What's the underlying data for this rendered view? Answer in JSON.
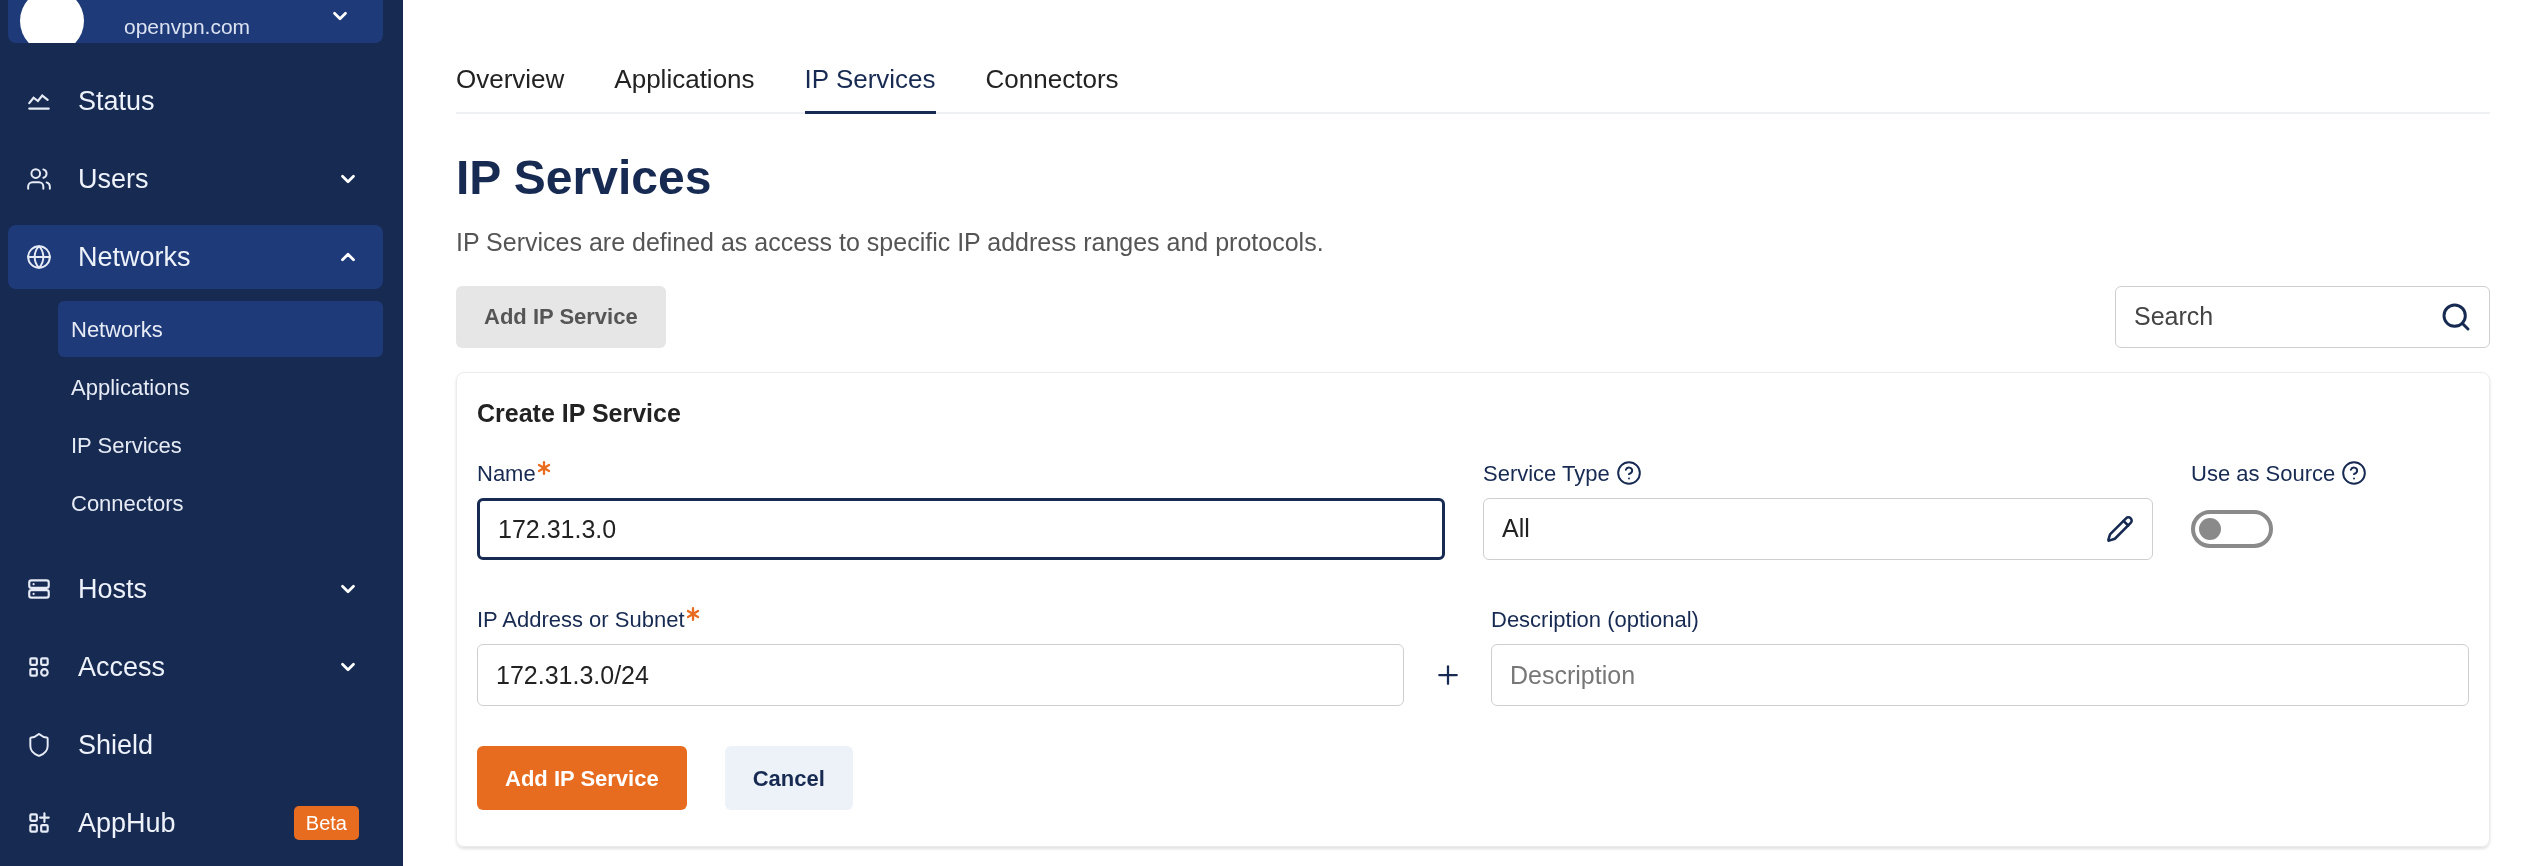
{
  "org": {
    "domain": "openvpn.com"
  },
  "sidebar": {
    "items": [
      {
        "kind": "status",
        "label": "Status",
        "selected": false
      },
      {
        "kind": "users",
        "label": "Users",
        "selected": false,
        "expanded": false
      },
      {
        "kind": "networks",
        "label": "Networks",
        "selected": true,
        "expanded": true,
        "children": [
          {
            "label": "Networks",
            "selected": true
          },
          {
            "label": "Applications",
            "selected": false
          },
          {
            "label": "IP Services",
            "selected": false
          },
          {
            "label": "Connectors",
            "selected": false
          }
        ]
      },
      {
        "kind": "hosts",
        "label": "Hosts",
        "selected": false,
        "expanded": false
      },
      {
        "kind": "access",
        "label": "Access",
        "selected": false,
        "expanded": false
      },
      {
        "kind": "shield",
        "label": "Shield",
        "selected": false
      },
      {
        "kind": "apphub",
        "label": "AppHub",
        "selected": false,
        "badge": "Beta"
      }
    ]
  },
  "tabs": [
    {
      "label": "Overview",
      "selected": false
    },
    {
      "label": "Applications",
      "selected": false
    },
    {
      "label": "IP Services",
      "selected": true
    },
    {
      "label": "Connectors",
      "selected": false
    }
  ],
  "page": {
    "title": "IP Services",
    "description": "IP Services are defined as access to specific IP address ranges and protocols."
  },
  "toolbar": {
    "add_button": "Add IP Service",
    "search": {
      "placeholder": "Search"
    }
  },
  "form": {
    "title": "Create IP Service",
    "name": {
      "label": "Name",
      "required": true,
      "value": "172.31.3.0",
      "focused": true
    },
    "service_type": {
      "label": "Service Type",
      "value": "All"
    },
    "use_as_source": {
      "label": "Use as Source",
      "on": false
    },
    "address": {
      "label": "IP Address or Subnet",
      "required": true,
      "value": "172.31.3.0/24"
    },
    "description": {
      "label": "Description (optional)",
      "placeholder": "Description"
    },
    "submit": "Add IP Service",
    "cancel": "Cancel"
  }
}
